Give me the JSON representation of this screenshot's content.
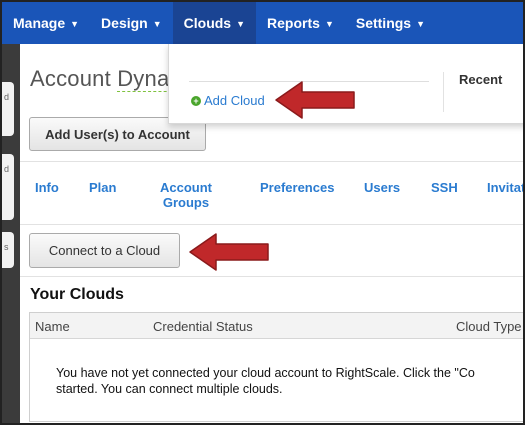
{
  "nav": {
    "items": [
      {
        "label": "Manage"
      },
      {
        "label": "Design"
      },
      {
        "label": "Clouds"
      },
      {
        "label": "Reports"
      },
      {
        "label": "Settings"
      }
    ],
    "active": "Clouds"
  },
  "left_cards": [
    "d",
    "d",
    "s"
  ],
  "page": {
    "title_prefix": "Account",
    "title_suffix": "Dynar"
  },
  "buttons": {
    "add_user": "Add User(s) to Account",
    "connect": "Connect to a Cloud"
  },
  "tabs": [
    {
      "label": "Info"
    },
    {
      "label": "Plan"
    },
    {
      "label": "Account\nGroups"
    },
    {
      "label": "Preferences"
    },
    {
      "label": "Users"
    },
    {
      "label": "SSH"
    },
    {
      "label": "Invitati"
    }
  ],
  "clouds": {
    "heading": "Your Clouds",
    "columns": [
      "Name",
      "Credential Status",
      "Cloud Type"
    ],
    "empty_line1": "You have not yet connected your cloud account to RightScale. Click the \"Co",
    "empty_line2": "started. You can connect multiple clouds."
  },
  "dropdown": {
    "add_cloud": "Add Cloud",
    "recent": "Recent"
  },
  "colors": {
    "nav_bg": "#1a55b8",
    "nav_active": "#1a4493",
    "link": "#2a7bd0",
    "arrow": "#c0282a"
  }
}
